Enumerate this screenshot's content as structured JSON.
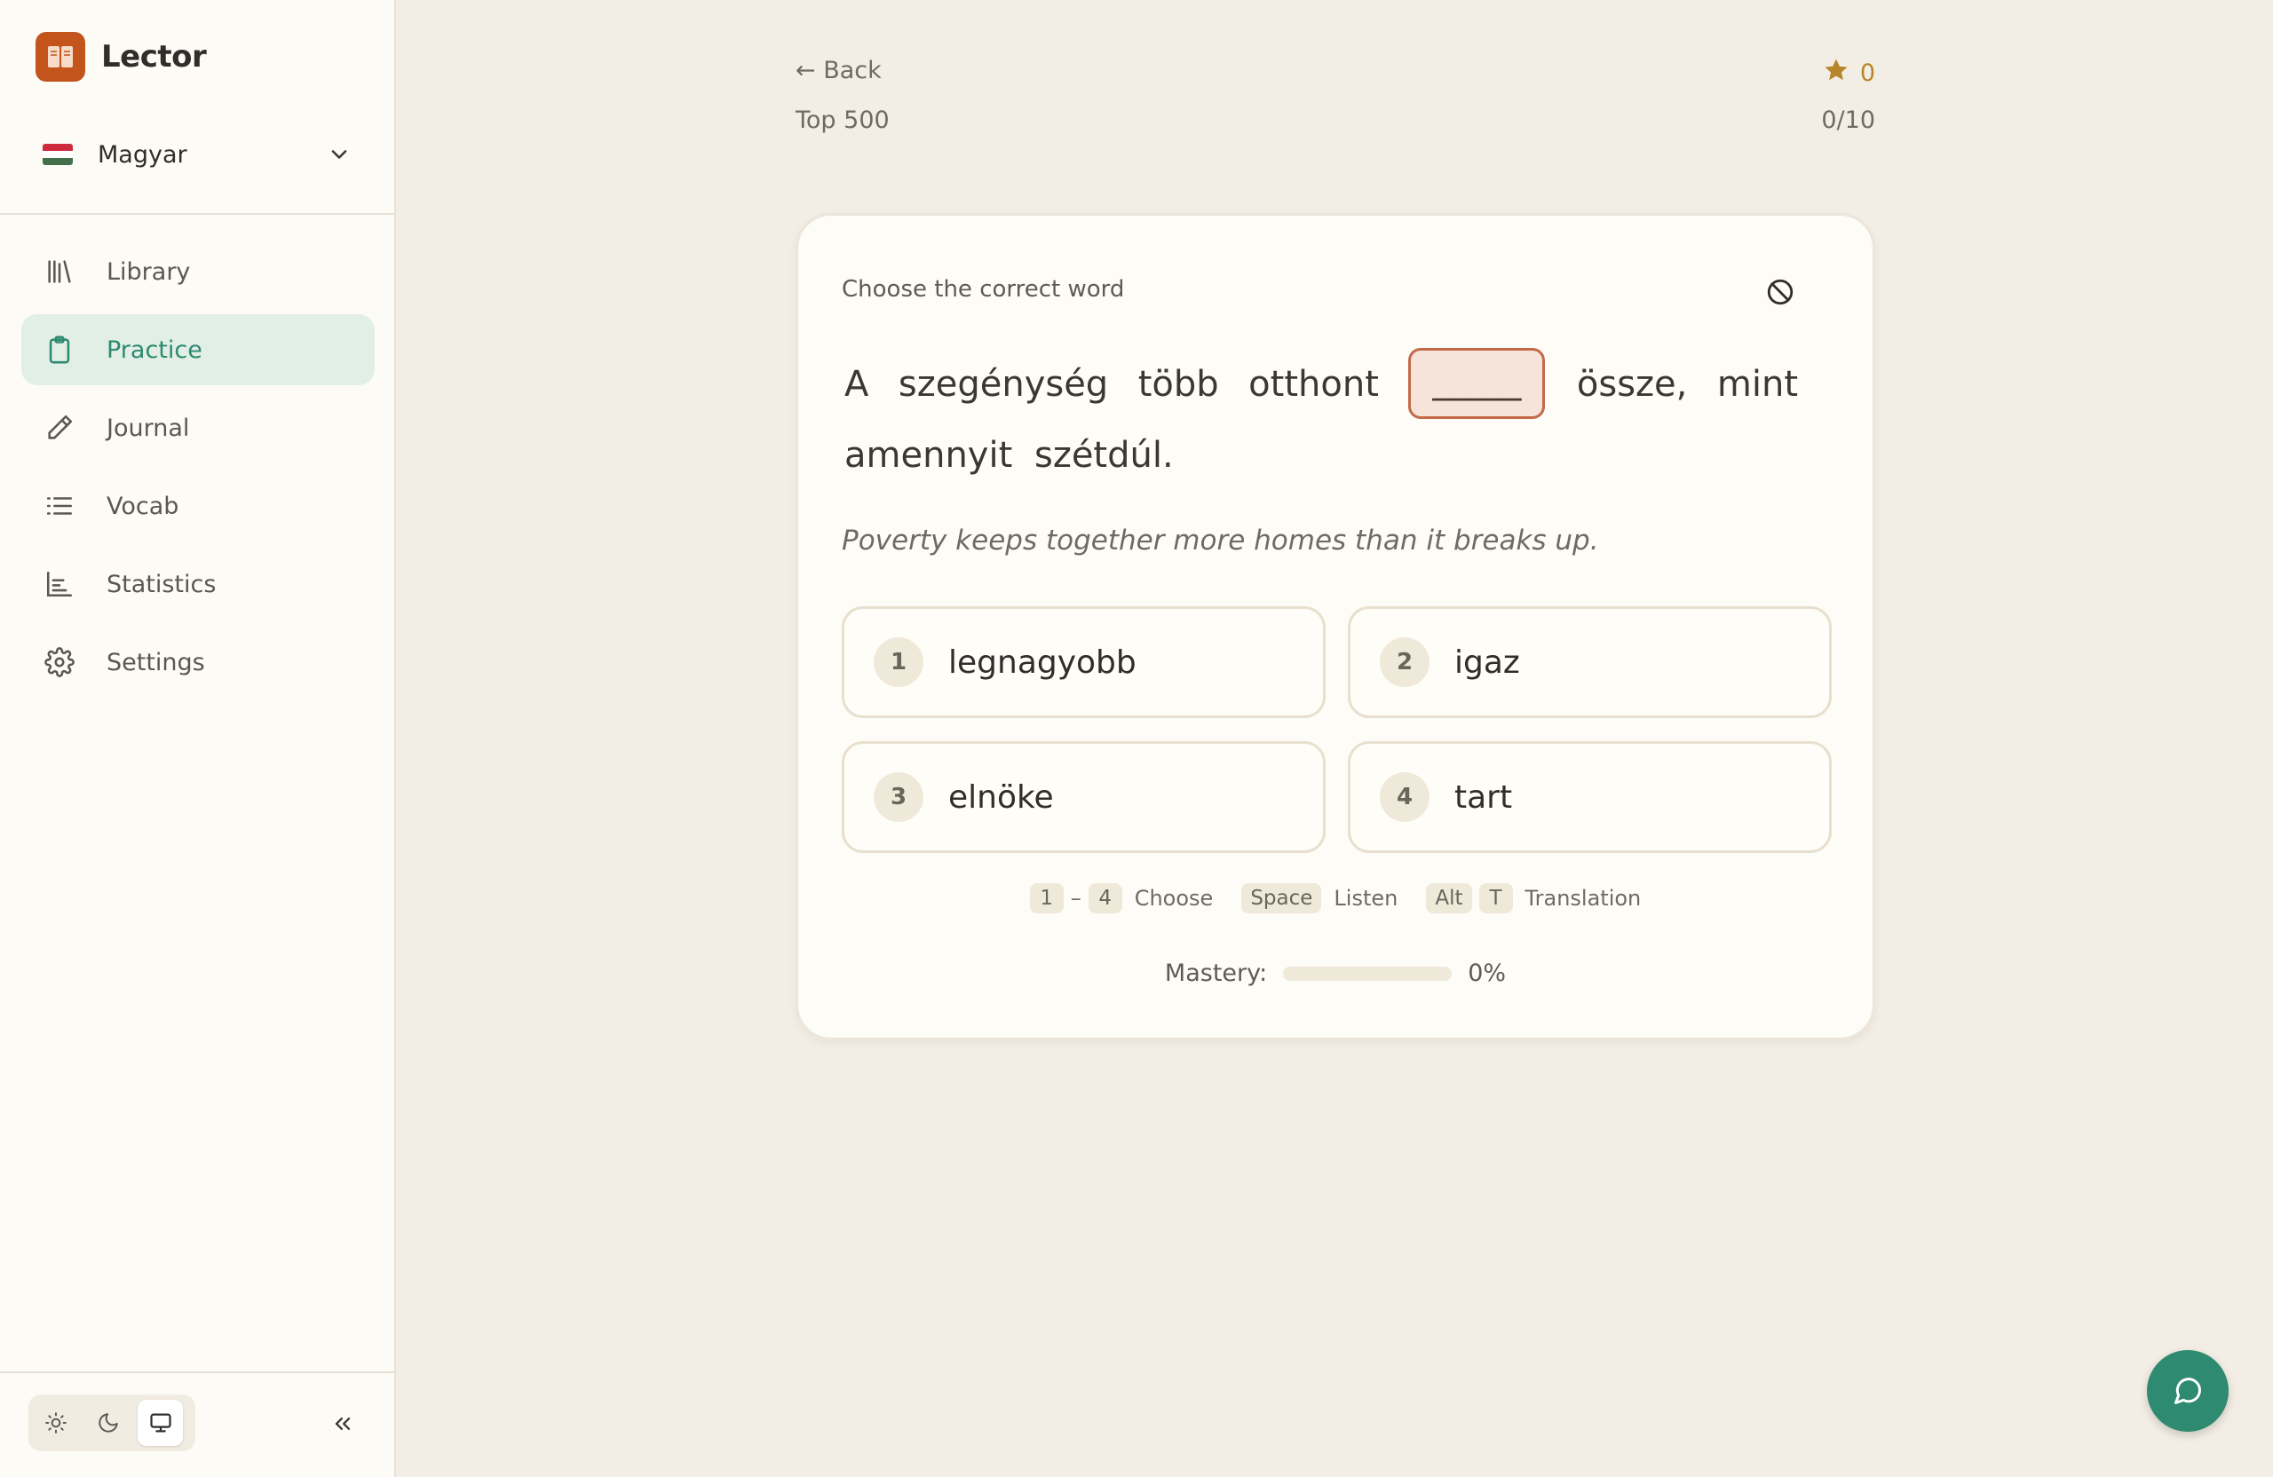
{
  "app": {
    "name": "Lector"
  },
  "language": {
    "label": "Magyar",
    "flag_colors": [
      "#cd2a3e",
      "#ffffff",
      "#436f4d"
    ]
  },
  "nav": {
    "items": [
      {
        "label": "Library",
        "icon": "library-icon"
      },
      {
        "label": "Practice",
        "icon": "clipboard-icon",
        "active": true
      },
      {
        "label": "Journal",
        "icon": "pencil-icon"
      },
      {
        "label": "Vocab",
        "icon": "list-icon"
      },
      {
        "label": "Statistics",
        "icon": "bar-chart-icon"
      },
      {
        "label": "Settings",
        "icon": "gear-icon"
      }
    ]
  },
  "theme": {
    "options": [
      "light",
      "dark",
      "system"
    ],
    "selected": "system"
  },
  "header": {
    "back_label": "← Back",
    "deck_title": "Top 500",
    "score": "0",
    "progress": "0/10"
  },
  "exercise": {
    "instruction": "Choose the correct word",
    "sentence_before": [
      "A",
      "szegénység",
      "több",
      "otthont"
    ],
    "blank": "_____",
    "sentence_after": [
      "össze,",
      "mint",
      "amennyit",
      "szétdúl."
    ],
    "translation": "Poverty keeps together more homes than it breaks up.",
    "options": [
      {
        "num": "1",
        "word": "legnagyobb"
      },
      {
        "num": "2",
        "word": "igaz"
      },
      {
        "num": "3",
        "word": "elnöke"
      },
      {
        "num": "4",
        "word": "tart"
      }
    ]
  },
  "hints": {
    "range_start": "1",
    "range_sep": "–",
    "range_end": "4",
    "choose_label": "Choose",
    "space_key": "Space",
    "listen_label": "Listen",
    "alt_key": "Alt",
    "t_key": "T",
    "translation_label": "Translation"
  },
  "mastery": {
    "label": "Mastery:",
    "value_text": "0%",
    "value": 0
  },
  "colors": {
    "accent": "#2e8a70",
    "brand": "#c2541c",
    "star": "#b8862a",
    "blank_border": "#c46a4a"
  }
}
